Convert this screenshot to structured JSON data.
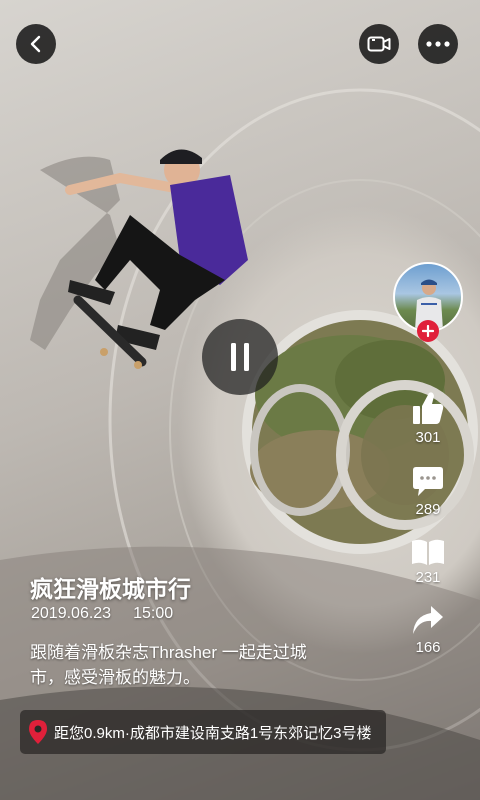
{
  "video": {
    "title": "疯狂滑板城市行",
    "date": "2019.06.23",
    "time": "15:00",
    "description": "跟随着滑板杂志Thrasher 一起走过城市，感受滑板的魅力。",
    "location": "距您0.9km·成都市建设南支路1号东郊记忆3号楼",
    "state": "paused"
  },
  "actions": {
    "likes": "301",
    "comments": "289",
    "collects": "231",
    "shares": "166"
  },
  "colors": {
    "follow_accent": "#e0203a",
    "pin": "#e0203a"
  },
  "icons": [
    "back-icon",
    "video-camera-icon",
    "more-icon",
    "pause-icon",
    "thumbs-up-icon",
    "comment-icon",
    "book-icon",
    "share-icon",
    "location-pin-icon",
    "plus-icon"
  ]
}
